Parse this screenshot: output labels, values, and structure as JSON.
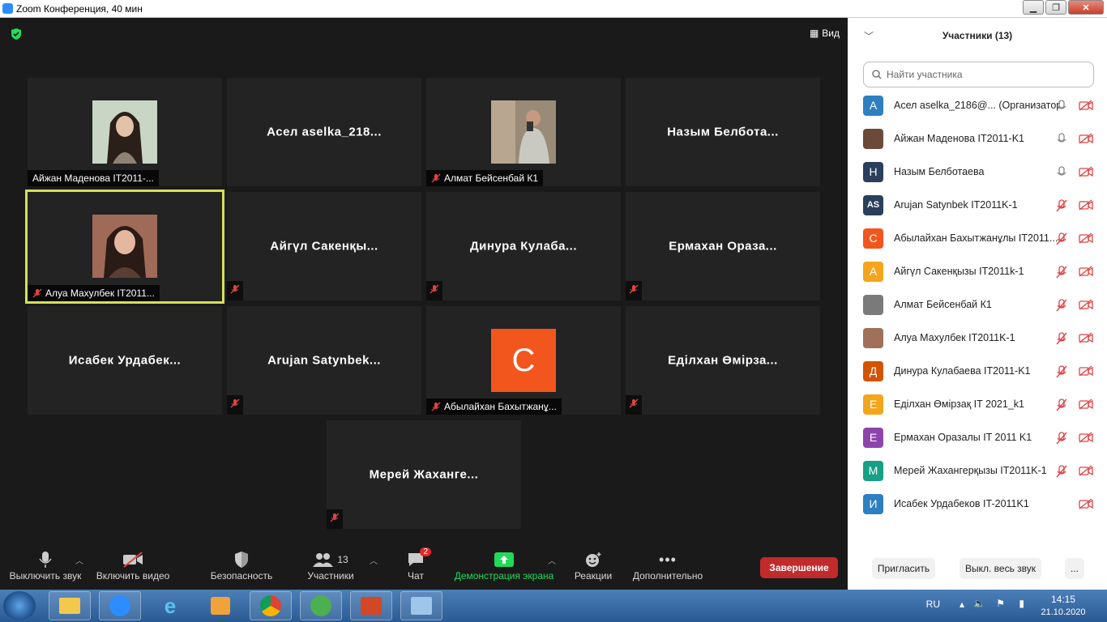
{
  "window": {
    "title": "Zoom Конференция, 40 мин",
    "minimize": "▁",
    "restore": "❐",
    "close": "✕"
  },
  "view_button": "Вид",
  "tiles": [
    {
      "name_center": "",
      "nametag": "Айжан Маденова IT2011-...",
      "muted": false,
      "photo": true
    },
    {
      "name_center": "Асел aselka_218...",
      "nametag": "",
      "muted": false,
      "photo": false
    },
    {
      "name_center": "",
      "nametag": "Алмат Бейсенбай К1",
      "muted": true,
      "photo": true
    },
    {
      "name_center": "Назым Белбота...",
      "nametag": "",
      "muted": false,
      "photo": false
    },
    {
      "name_center": "",
      "nametag": "Алуа Махулбек IT2011...",
      "muted": true,
      "photo": true,
      "active": true
    },
    {
      "name_center": "Айгүл Сакенқы...",
      "nametag": "",
      "muted": true,
      "photo": false
    },
    {
      "name_center": "Динура Кулаба...",
      "nametag": "",
      "muted": true,
      "photo": false
    },
    {
      "name_center": "Ермахан Ораза...",
      "nametag": "",
      "muted": true,
      "photo": false
    },
    {
      "name_center": "Исабек Урдабек...",
      "nametag": "",
      "muted": false,
      "photo": false
    },
    {
      "name_center": "Arujan Satynbek...",
      "nametag": "",
      "muted": true,
      "photo": false
    },
    {
      "name_center": "",
      "nametag": "Абылайхан Бахытжанұ...",
      "muted": true,
      "avatar_letter": "C"
    },
    {
      "name_center": "Еділхан Өмірза...",
      "nametag": "",
      "muted": true,
      "photo": false
    },
    {
      "name_center": "Мерей Жаханге...",
      "nametag": "",
      "muted": true,
      "photo": false
    }
  ],
  "toolbar": {
    "mute": "Выключить звук",
    "video": "Включить видео",
    "security": "Безопасность",
    "participants": "Участники",
    "participants_count": "13",
    "chat": "Чат",
    "chat_badge": "2",
    "share": "Демонстрация экрана",
    "reactions": "Реакции",
    "more": "Дополнительно",
    "end": "Завершение"
  },
  "panel": {
    "title": "Участники (13)",
    "search_placeholder": "Найти участника",
    "participants": [
      {
        "initials": "A",
        "name": "Асел aselka_2186@... (Организатор, я)",
        "color": "#2d7fc1"
      },
      {
        "initials": "",
        "name": "Айжан Маденова IT2011-K1",
        "color": "#6b4a3a"
      },
      {
        "initials": "H",
        "name": "Назым Белботаева",
        "color": "#2b3f5c"
      },
      {
        "initials": "AS",
        "name": "Arujan Satynbek IT2011K-1",
        "color": "#2b3f5c"
      },
      {
        "initials": "C",
        "name": "Абылайхан Бахытжанұлы IT2011...",
        "color": "#f2561d"
      },
      {
        "initials": "A",
        "name": "Айгүл Сакенқызы IT2011k-1",
        "color": "#f4a51c"
      },
      {
        "initials": "",
        "name": "Алмат Бейсенбай К1",
        "color": "#7a7a7a"
      },
      {
        "initials": "",
        "name": "Алуа Махулбек IT2011K-1",
        "color": "#a0705a"
      },
      {
        "initials": "Д",
        "name": "Динура Кулабаева IT2011-K1",
        "color": "#d35400"
      },
      {
        "initials": "E",
        "name": "Еділхан Өмірзақ IT 2021_k1",
        "color": "#f4a51c"
      },
      {
        "initials": "E",
        "name": "Ермахан Оразалы IT 2011 K1",
        "color": "#8e44ad"
      },
      {
        "initials": "M",
        "name": "Мерей Жахангерқызы IT2011K-1",
        "color": "#16a085"
      },
      {
        "initials": "И",
        "name": "Исабек Урдабеков IT-2011K1",
        "color": "#2d7fc1"
      }
    ],
    "invite": "Пригласить",
    "mute_all": "Выкл. весь звук",
    "more": "..."
  },
  "taskbar": {
    "lang": "RU",
    "time": "14:15",
    "date": "21.10.2020"
  }
}
